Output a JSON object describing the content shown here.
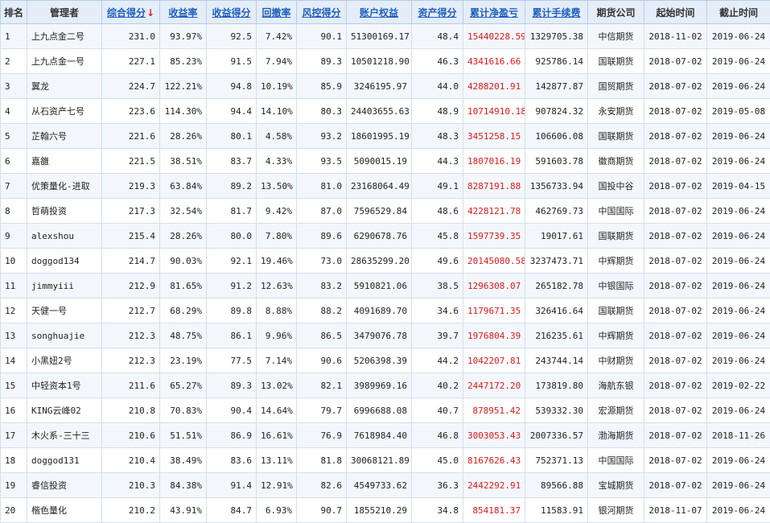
{
  "table": {
    "headers": [
      {
        "key": "rank",
        "label": "排名",
        "sortable": false
      },
      {
        "key": "manager",
        "label": "管理者",
        "sortable": false
      },
      {
        "key": "composite",
        "label": "综合得分",
        "sortable": true,
        "sorted": true
      },
      {
        "key": "return_rate",
        "label": "收益率",
        "sortable": true
      },
      {
        "key": "return_score",
        "label": "收益得分",
        "sortable": true
      },
      {
        "key": "drawdown",
        "label": "回撤率",
        "sortable": true
      },
      {
        "key": "risk_score",
        "label": "风控得分",
        "sortable": true
      },
      {
        "key": "equity",
        "label": "账户权益",
        "sortable": true
      },
      {
        "key": "asset_score",
        "label": "资产得分",
        "sortable": true
      },
      {
        "key": "net_pnl",
        "label": "累计净盈亏",
        "sortable": true
      },
      {
        "key": "fees",
        "label": "累计手续费",
        "sortable": true
      },
      {
        "key": "company",
        "label": "期货公司",
        "sortable": false
      },
      {
        "key": "start",
        "label": "起始时间",
        "sortable": false
      },
      {
        "key": "end",
        "label": "截止时间",
        "sortable": false
      }
    ],
    "sort_arrow": "↓",
    "sort_arrow_color": "#e02020",
    "link_color": "#1f5fbf",
    "pnl_color": "#e01818",
    "rows": [
      [
        "1",
        "上九点金二号",
        "231.0",
        "93.97%",
        "92.5",
        "7.42%",
        "90.1",
        "51300169.17",
        "48.4",
        "15440228.59",
        "1329705.38",
        "中信期货",
        "2018-11-02",
        "2019-06-24"
      ],
      [
        "2",
        "上九点金一号",
        "227.1",
        "85.23%",
        "91.5",
        "7.94%",
        "89.3",
        "10501218.90",
        "46.3",
        "4341616.66",
        "925786.14",
        "国联期货",
        "2018-07-02",
        "2019-06-24"
      ],
      [
        "3",
        "翼龙",
        "224.7",
        "122.21%",
        "94.8",
        "10.19%",
        "85.9",
        "3246195.97",
        "44.0",
        "4288201.91",
        "142877.87",
        "国贸期货",
        "2018-07-02",
        "2019-06-24"
      ],
      [
        "4",
        "从石资产七号",
        "223.6",
        "114.30%",
        "94.4",
        "14.10%",
        "80.3",
        "24403655.63",
        "48.9",
        "10714910.18",
        "907824.32",
        "永安期货",
        "2018-07-02",
        "2019-05-08"
      ],
      [
        "5",
        "芷翰六号",
        "221.6",
        "28.26%",
        "80.1",
        "4.58%",
        "93.2",
        "18601995.19",
        "48.3",
        "3451258.15",
        "106606.08",
        "国联期货",
        "2018-07-02",
        "2019-06-24"
      ],
      [
        "6",
        "嘉雒",
        "221.5",
        "38.51%",
        "83.7",
        "4.33%",
        "93.5",
        "5090015.19",
        "44.3",
        "1807016.19",
        "591603.78",
        "徽商期货",
        "2018-07-02",
        "2019-06-24"
      ],
      [
        "7",
        "优策量化-进取",
        "219.3",
        "63.84%",
        "89.2",
        "13.50%",
        "81.0",
        "23168064.49",
        "49.1",
        "8287191.88",
        "1356733.94",
        "国投中谷",
        "2018-07-02",
        "2019-04-15"
      ],
      [
        "8",
        "哲萌投资",
        "217.3",
        "32.54%",
        "81.7",
        "9.42%",
        "87.0",
        "7596529.84",
        "48.6",
        "4228121.78",
        "462769.73",
        "中国国际",
        "2018-07-02",
        "2019-06-24"
      ],
      [
        "9",
        "alexshou",
        "215.4",
        "28.26%",
        "80.0",
        "7.80%",
        "89.6",
        "6290678.76",
        "45.8",
        "1597739.35",
        "19017.61",
        "国联期货",
        "2018-07-02",
        "2019-06-24"
      ],
      [
        "10",
        "doggod134",
        "214.7",
        "90.03%",
        "92.1",
        "19.46%",
        "73.0",
        "28635299.20",
        "49.6",
        "20145080.58",
        "3237473.71",
        "中辉期货",
        "2018-07-02",
        "2019-06-24"
      ],
      [
        "11",
        "jimmyiii",
        "212.9",
        "81.65%",
        "91.2",
        "12.63%",
        "83.2",
        "5910821.06",
        "38.5",
        "1296308.07",
        "265182.78",
        "中银国际",
        "2018-07-02",
        "2019-06-24"
      ],
      [
        "12",
        "天健一号",
        "212.7",
        "68.29%",
        "89.8",
        "8.88%",
        "88.2",
        "4091689.70",
        "34.6",
        "1179671.35",
        "326416.64",
        "国联期货",
        "2018-07-02",
        "2019-06-24"
      ],
      [
        "13",
        "songhuajie",
        "212.3",
        "48.75%",
        "86.1",
        "9.96%",
        "86.5",
        "3479076.78",
        "39.7",
        "1976804.39",
        "216235.61",
        "中辉期货",
        "2018-07-02",
        "2019-06-24"
      ],
      [
        "14",
        "小黑妞2号",
        "212.3",
        "23.19%",
        "77.5",
        "7.14%",
        "90.6",
        "5206398.39",
        "44.2",
        "1042207.81",
        "243744.14",
        "中财期货",
        "2018-07-02",
        "2019-06-24"
      ],
      [
        "15",
        "中轻资本1号",
        "211.6",
        "65.27%",
        "89.3",
        "13.02%",
        "82.1",
        "3989969.16",
        "40.2",
        "2447172.20",
        "173819.80",
        "海航东银",
        "2018-07-02",
        "2019-02-22"
      ],
      [
        "16",
        "KING云峰02",
        "210.8",
        "70.83%",
        "90.4",
        "14.64%",
        "79.7",
        "6996688.08",
        "40.7",
        "878951.42",
        "539332.30",
        "宏源期货",
        "2018-07-02",
        "2019-06-24"
      ],
      [
        "17",
        "木火系-三十三",
        "210.6",
        "51.51%",
        "86.9",
        "16.61%",
        "76.9",
        "7618984.40",
        "46.8",
        "3003053.43",
        "2007336.57",
        "渤海期货",
        "2018-07-02",
        "2018-11-26"
      ],
      [
        "18",
        "doggod131",
        "210.4",
        "38.49%",
        "83.6",
        "13.11%",
        "81.8",
        "30068121.89",
        "45.0",
        "8167626.43",
        "752371.13",
        "中国国际",
        "2018-07-02",
        "2019-06-24"
      ],
      [
        "19",
        "睿信投资",
        "210.3",
        "84.38%",
        "91.4",
        "12.91%",
        "82.6",
        "4549733.62",
        "36.3",
        "2442292.91",
        "89566.88",
        "宝城期货",
        "2018-07-02",
        "2019-06-24"
      ],
      [
        "20",
        "楷色量化",
        "210.2",
        "43.91%",
        "84.7",
        "6.93%",
        "90.7",
        "1855210.29",
        "34.8",
        "854181.37",
        "11583.91",
        "银河期货",
        "2018-11-07",
        "2019-06-24"
      ]
    ]
  }
}
